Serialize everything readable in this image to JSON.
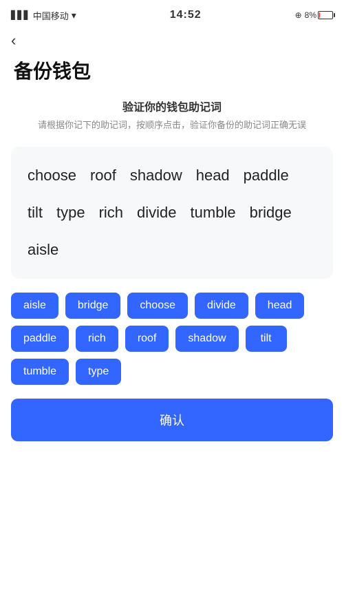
{
  "statusBar": {
    "carrier": "中国移动",
    "time": "14:52",
    "batteryPercent": "8%"
  },
  "backButton": {
    "label": "‹"
  },
  "pageTitle": "备份钱包",
  "sectionHeader": {
    "title": "验证你的钱包助记词",
    "desc": "请根据你记下的助记词，按顺序点击，验证你备份的助记词正确无误"
  },
  "selectedWords": [
    "choose",
    "roof",
    "shadow",
    "head",
    "paddle",
    "tilt",
    "type",
    "rich",
    "divide",
    "tumble",
    "bridge",
    "aisle"
  ],
  "wordButtons": [
    "aisle",
    "bridge",
    "choose",
    "divide",
    "head",
    "paddle",
    "rich",
    "roof",
    "shadow",
    "tilt",
    "tumble",
    "type"
  ],
  "confirmButton": {
    "label": "确认"
  }
}
